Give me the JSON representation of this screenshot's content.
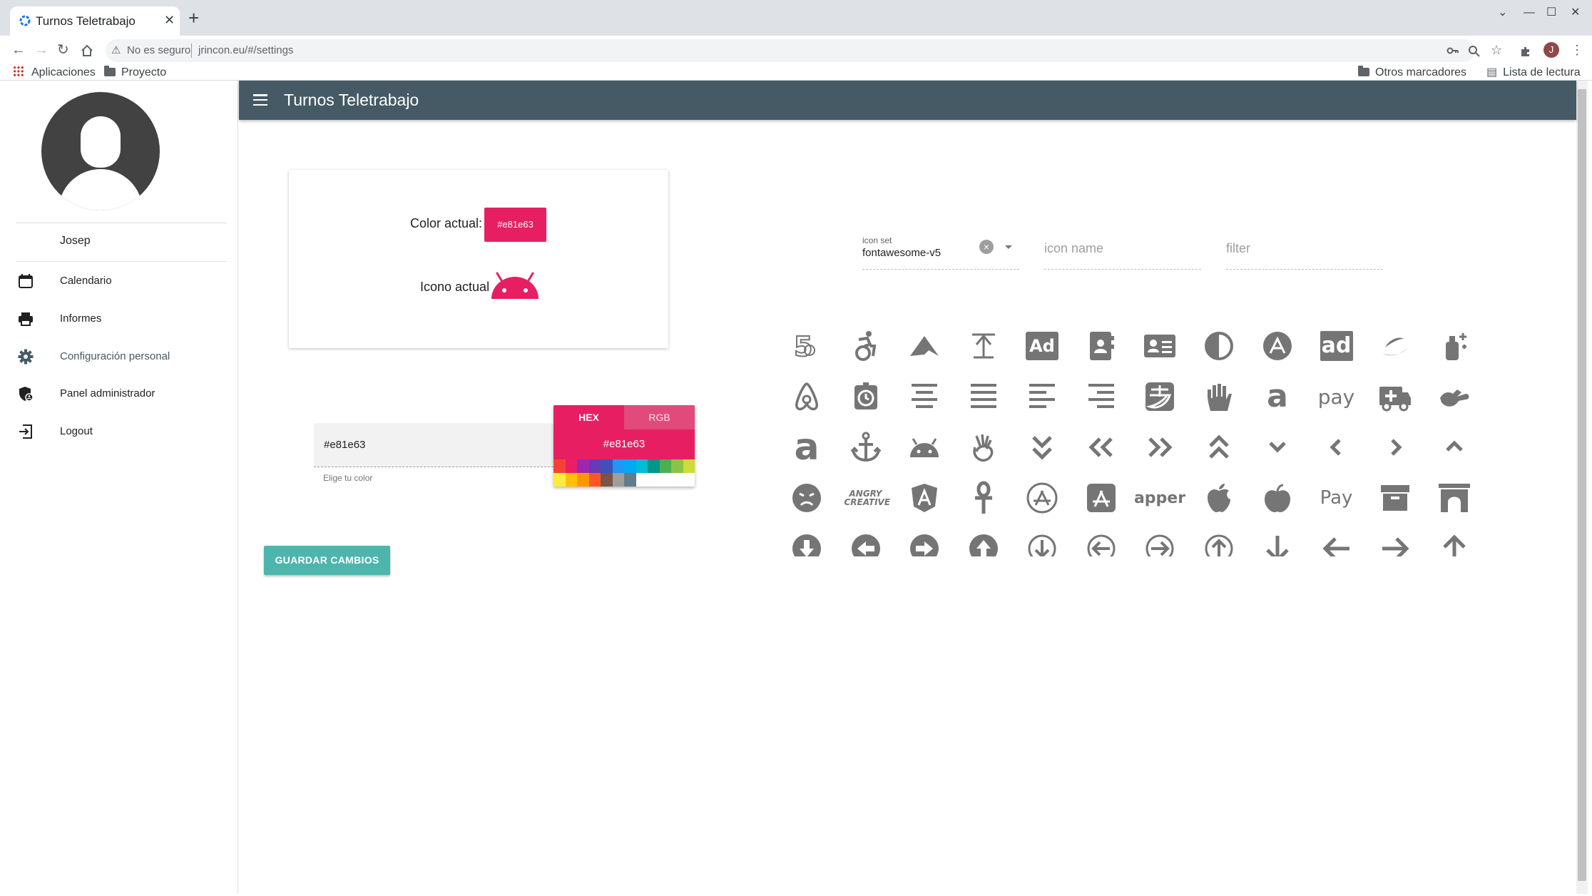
{
  "browser": {
    "tab_title": "Turnos Teletrabajo",
    "new_tab": "+",
    "close_tab": "✕",
    "window_controls": [
      "⌄",
      "—",
      "☐",
      "✕"
    ],
    "security_label": "No es seguro",
    "url": "jrincon.eu/#/settings",
    "profile_initial": "J",
    "bookmarks": {
      "apps": "Aplicaciones",
      "project": "Proyecto",
      "other": "Otros marcadores",
      "reading_list": "Lista de lectura"
    }
  },
  "app": {
    "title": "Turnos Teletrabajo"
  },
  "sidebar": {
    "user_name": "Josep",
    "items": [
      {
        "label": "Calendario",
        "icon": "calendar-icon"
      },
      {
        "label": "Informes",
        "icon": "printer-icon"
      },
      {
        "label": "Configuración personal",
        "icon": "gear-icon",
        "active": true
      },
      {
        "label": "Panel administrador",
        "icon": "admin-shield-icon"
      },
      {
        "label": "Logout",
        "icon": "logout-icon"
      }
    ]
  },
  "settings": {
    "color_label": "Color actual:",
    "color_value": "#e81e63",
    "icon_label": "Icono actual",
    "current_icon": "android-icon",
    "picker_value": "#e81e63",
    "picker_hint": "Elige tu color",
    "picker_tabs": [
      "HEX",
      "RGB"
    ],
    "picker_display": "#e81e63",
    "swatches_row1": [
      "#f44336",
      "#e91e63",
      "#9c27b0",
      "#673ab7",
      "#3f51b5",
      "#2196f3",
      "#03a9f4",
      "#00bcd4",
      "#009688",
      "#4caf50",
      "#8bc34a",
      "#cddc39"
    ],
    "swatches_row2": [
      "#ffeb3b",
      "#ffc107",
      "#ff9800",
      "#ff5722",
      "#795548",
      "#9e9e9e",
      "#607d8b",
      "#ffffff"
    ],
    "save_button": "GUARDAR CAMBIOS"
  },
  "icon_browser": {
    "icon_set_label": "icon set",
    "icon_set_value": "fontawesome-v5",
    "icon_name_placeholder": "icon name",
    "filter_placeholder": "filter",
    "icon_color": "#757575",
    "icons": [
      "500px",
      "accessible-icon",
      "accusoft",
      "acquisitions-incorporated",
      "ad",
      "address-book",
      "address-card",
      "adjust",
      "adn",
      "adversal",
      "affiliatetheme",
      "air-freshener",
      "airbnb",
      "alarm-clock",
      "align-center",
      "align-justify",
      "align-left",
      "align-right",
      "alipay",
      "allergies",
      "amazon",
      "amazon-pay",
      "ambulance",
      "american-sign-language-interpreting",
      "amilia",
      "anchor",
      "android",
      "angellist",
      "angle-double-down",
      "angle-double-left",
      "angle-double-right",
      "angle-double-up",
      "angle-down",
      "angle-left",
      "angle-right",
      "angle-up",
      "angry",
      "angrycreative",
      "angular",
      "ankh",
      "app-store",
      "app-store-ios",
      "apper",
      "apple",
      "apple-alt",
      "apple-pay",
      "archive",
      "archway",
      "arrow-alt-circle-down",
      "arrow-alt-circle-left",
      "arrow-alt-circle-right",
      "arrow-alt-circle-up",
      "arrow-circle-down",
      "arrow-circle-left",
      "arrow-circle-right",
      "arrow-circle-up",
      "arrow-down",
      "arrow-left",
      "arrow-right",
      "arrow-up"
    ],
    "text_icons": {
      "ad": "Ad",
      "adversal": "ad",
      "amazon": "a",
      "amazon-pay": "pay",
      "amilia": "a",
      "angrycreative": "ANGRY CREATIVE",
      "apper": "apper",
      "apple-pay": " Pay"
    }
  }
}
